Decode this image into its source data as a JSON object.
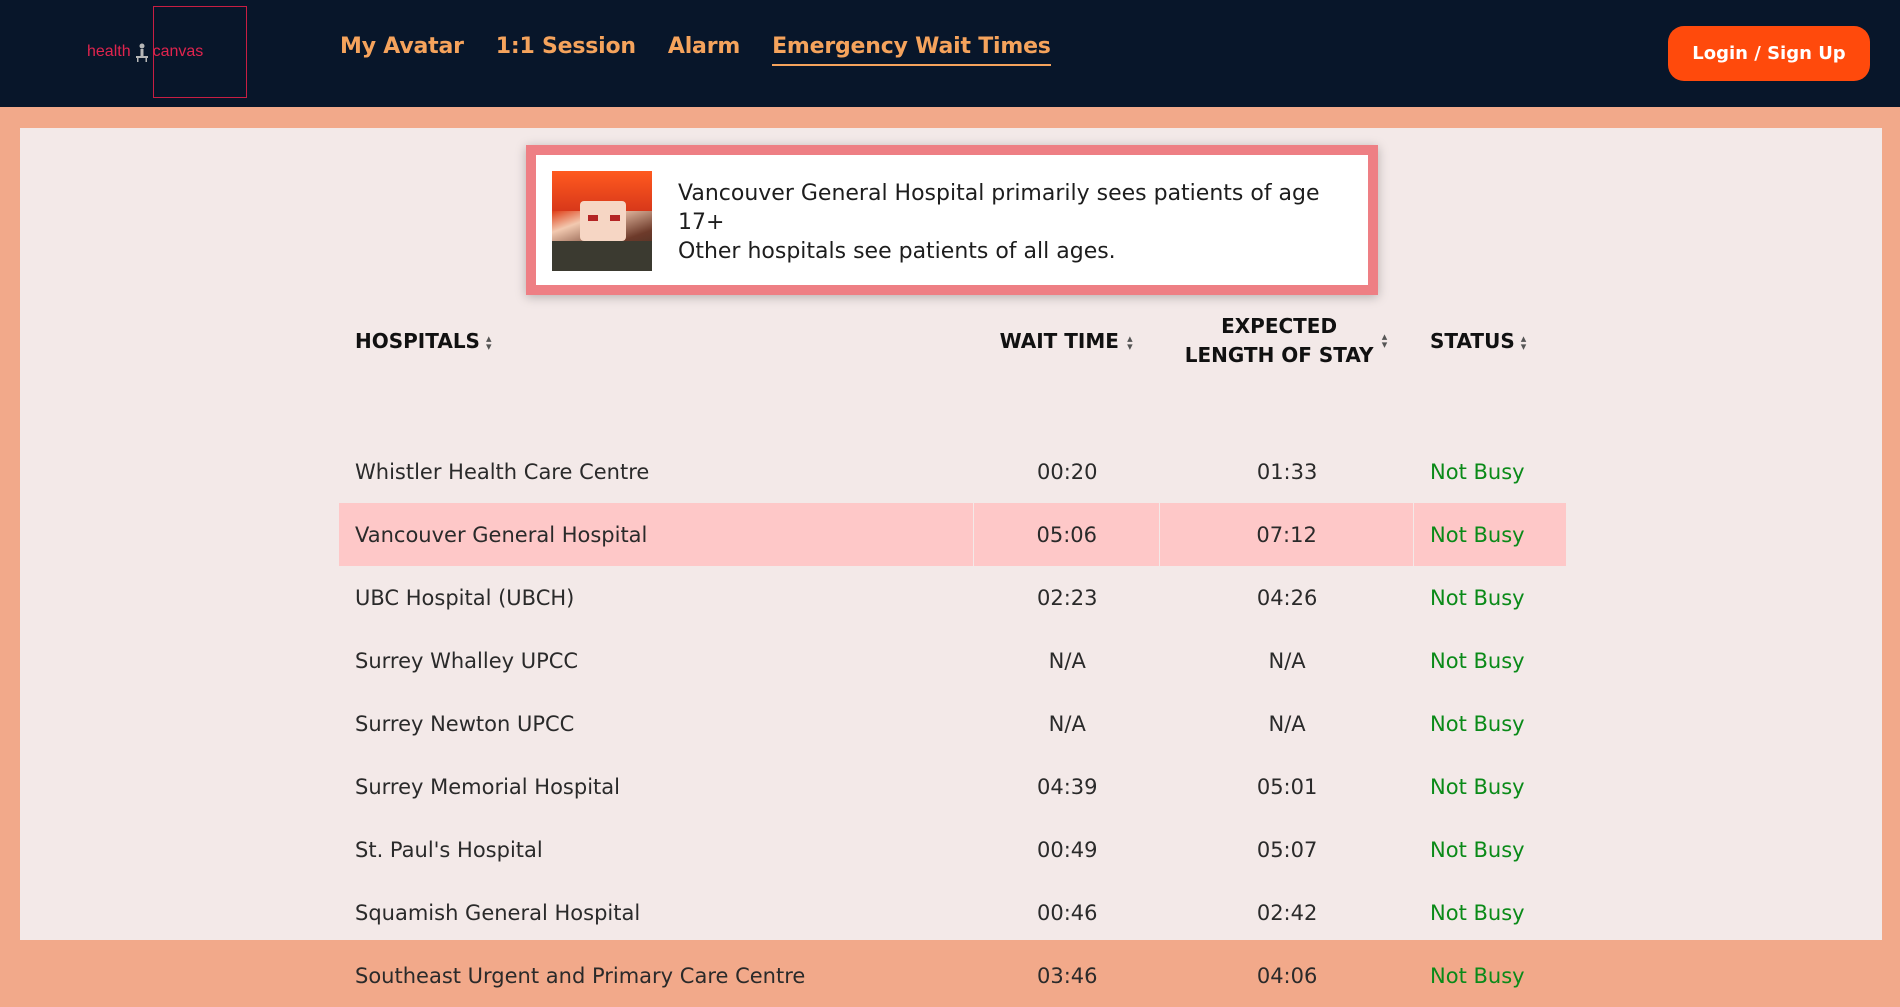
{
  "header": {
    "logo_left": "health",
    "logo_right": "canvas",
    "nav": [
      {
        "label": "My Avatar"
      },
      {
        "label": "1:1 Session"
      },
      {
        "label": "Alarm"
      },
      {
        "label": "Emergency Wait Times",
        "active": true
      }
    ],
    "login_label": "Login / Sign Up"
  },
  "notice": {
    "line1": "Vancouver General Hospital primarily sees patients of age 17+",
    "line2": "Other hospitals see patients of all ages."
  },
  "table": {
    "columns": {
      "hospitals": "HOSPITALS",
      "wait_time": "WAIT TIME",
      "stay_line1": "EXPECTED",
      "stay_line2": "LENGTH OF STAY",
      "status": "STATUS"
    },
    "rows": [
      {
        "name": "Whistler Health Care Centre",
        "wait": "00:20",
        "stay": "01:33",
        "status": "Not Busy"
      },
      {
        "name": "Vancouver General Hospital",
        "wait": "05:06",
        "stay": "07:12",
        "status": "Not Busy"
      },
      {
        "name": "UBC Hospital (UBCH)",
        "wait": "02:23",
        "stay": "04:26",
        "status": "Not Busy"
      },
      {
        "name": "Surrey Whalley UPCC",
        "wait": "N/A",
        "stay": "N/A",
        "status": "Not Busy"
      },
      {
        "name": "Surrey Newton UPCC",
        "wait": "N/A",
        "stay": "N/A",
        "status": "Not Busy"
      },
      {
        "name": "Surrey Memorial Hospital",
        "wait": "04:39",
        "stay": "05:01",
        "status": "Not Busy"
      },
      {
        "name": "St. Paul's Hospital",
        "wait": "00:49",
        "stay": "05:07",
        "status": "Not Busy"
      },
      {
        "name": "Squamish General Hospital",
        "wait": "00:46",
        "stay": "02:42",
        "status": "Not Busy"
      },
      {
        "name": "Southeast Urgent and Primary Care Centre",
        "wait": "03:46",
        "stay": "04:06",
        "status": "Not Busy"
      }
    ]
  },
  "colors": {
    "nav_bg": "#08162a",
    "nav_text": "#f5a35c",
    "login_bg": "#ff4a0c",
    "status_green": "#0a8a18",
    "highlight_row": "#fec8c8",
    "notice_border": "#ee7f84"
  }
}
